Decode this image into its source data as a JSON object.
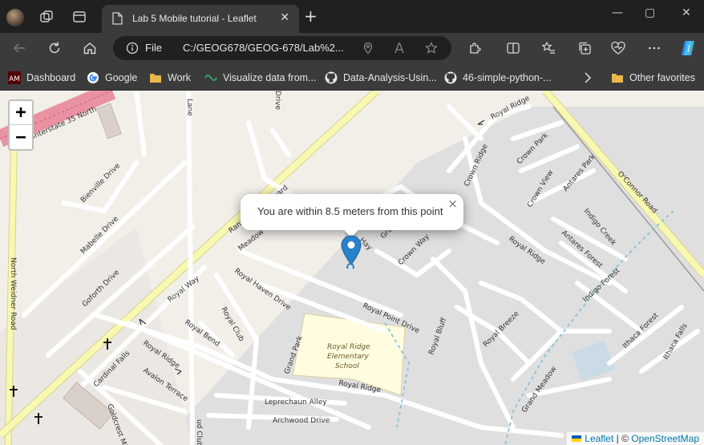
{
  "tab": {
    "title": "Lab 5 Mobile tutorial - Leaflet",
    "close": "✕",
    "new": "+"
  },
  "window": {
    "min": "—",
    "max": "▢",
    "close": "✕"
  },
  "address": {
    "scheme": "File",
    "url": "C:/GEOG678/GEOG-678/Lab%2..."
  },
  "bookmarks": [
    {
      "label": "Dashboard",
      "icon": "tamu-icon"
    },
    {
      "label": "Google",
      "icon": "google-icon"
    },
    {
      "label": "Work",
      "icon": "folder-icon"
    },
    {
      "label": "Visualize data from...",
      "icon": "link-icon"
    },
    {
      "label": "Data-Analysis-Usin...",
      "icon": "github-icon"
    },
    {
      "label": "46-simple-python-...",
      "icon": "github-icon"
    }
  ],
  "bookmarks_more": "Other favorites",
  "zoom": {
    "in": "+",
    "out": "−"
  },
  "popup": {
    "text": "You are within 8.5 meters from this point",
    "close": "×"
  },
  "attribution": {
    "leaflet": "Leaflet",
    "sep": " | © ",
    "osm": "OpenStreetMap"
  },
  "map_labels": {
    "interstate": "Interstate 35 North",
    "royal_ridge": "Royal Ridge",
    "crown_park": "Crown Park",
    "crown_ridge": "Crown Ridge",
    "crown_view": "Crown View",
    "antares_park": "Antares Park",
    "oconnor": "O'Connor Road",
    "indigo_creek": "Indigo Creek",
    "antares_forest": "Antares Forest",
    "indigo_forest": "Indigo Forest",
    "bienville": "Bienville Drive",
    "mabelle": "Mabelle Drive",
    "goforth": "Goforth Drive",
    "north_weidner": "North Weidner Road",
    "meadow": "Meadow",
    "royal_haven": "Royal Haven Drive",
    "royal_way": "Royal Way",
    "royal_bend": "Royal Bend",
    "royal_club": "Royal Club",
    "crown_way": "Crown Way",
    "royal_point": "Royal Point Drive",
    "royal_bluff": "Royal Bluff",
    "royal_breeze": "Royal Breeze",
    "ithaca_forest": "Ithaca Forest",
    "ithaca_falls": "Ithaca Falls",
    "grand_park": "Grand Park",
    "school1": "Royal Ridge",
    "school2": "Elementary",
    "school3": "School",
    "cardinal_falls": "Cardinal Falls",
    "avalon_terrace": "Avalon Terrace",
    "leprechaun": "Leprechaun Alley",
    "archwood": "Archwood Drive",
    "goldcrest": "Goldcrest Mill",
    "grand_meadow": "Grand Meadow",
    "boulevard": "Randolph Boulevard",
    "hay": "Hay",
    "gra": "Gra",
    "lane": "Lane",
    "drive": "Drive",
    "ud_club": "ud Club"
  },
  "colors": {
    "accent": "#0078a8",
    "marker": "#2a81cb",
    "road_major": "#f8f8b0",
    "residential": "#e0e0e0",
    "school": "#fffce0"
  }
}
